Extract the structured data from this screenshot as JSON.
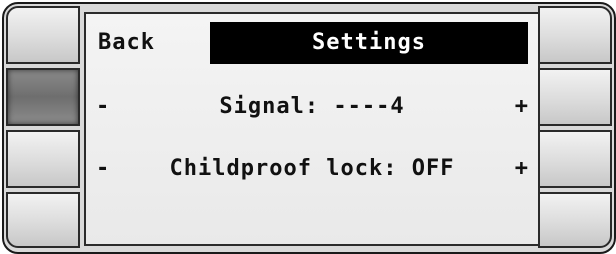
{
  "screen": {
    "back_label": "Back",
    "title": "Settings",
    "rows": [
      {
        "minus": "-",
        "text": "Signal: ----4",
        "plus": "+"
      },
      {
        "minus": "-",
        "text": "Childproof lock: OFF",
        "plus": "+"
      }
    ]
  }
}
